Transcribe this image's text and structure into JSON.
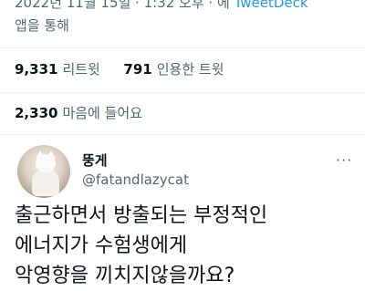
{
  "tweet_meta": {
    "date_time": "2022년 11월 15일 · 1:32 오후 · 에",
    "via": "TweetDeck",
    "via_suffix": "앱을 통해"
  },
  "stats": {
    "retweets_count": "9,331",
    "retweets_label": "리트윗",
    "quotes_count": "791",
    "quotes_label": "인용한 트윗",
    "likes_count": "2,330",
    "likes_label": "마음에 들어요"
  },
  "reply": {
    "display_name": "뚱게",
    "handle": "@fatandlazycat",
    "more_icon": "more-horizontal-icon",
    "text_lines": [
      "출근하면서 방출되는 부정적인",
      "에너지가 수험생에게",
      "악영향을 끼치지않을까요?"
    ]
  },
  "colors": {
    "link": "#1d9bf0",
    "secondary_text": "#536471",
    "primary_text": "#0f1419",
    "divider": "#eff3f4"
  }
}
